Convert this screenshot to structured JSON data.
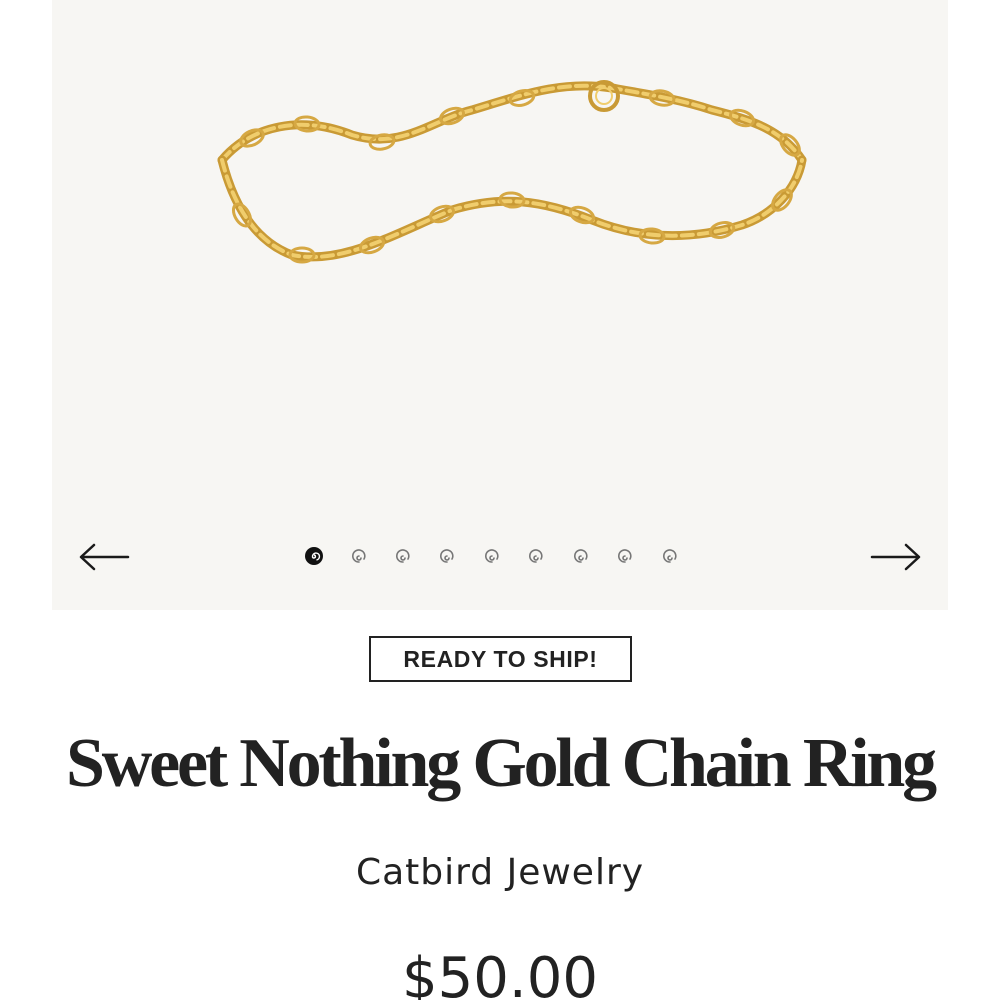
{
  "product": {
    "badge": "READY TO SHIP!",
    "title": "Sweet Nothing Gold Chain Ring",
    "brand": "Catbird Jewelry",
    "price": "$50.00"
  },
  "gallery": {
    "image_subject": "gold-chain-ring",
    "slide_count": 9,
    "active_slide": 1,
    "prev_icon": "arrow-left-icon",
    "next_icon": "arrow-right-icon"
  },
  "colors": {
    "gallery_background": "#f7f6f3",
    "gold": "#e3b84f",
    "text": "#222222"
  }
}
